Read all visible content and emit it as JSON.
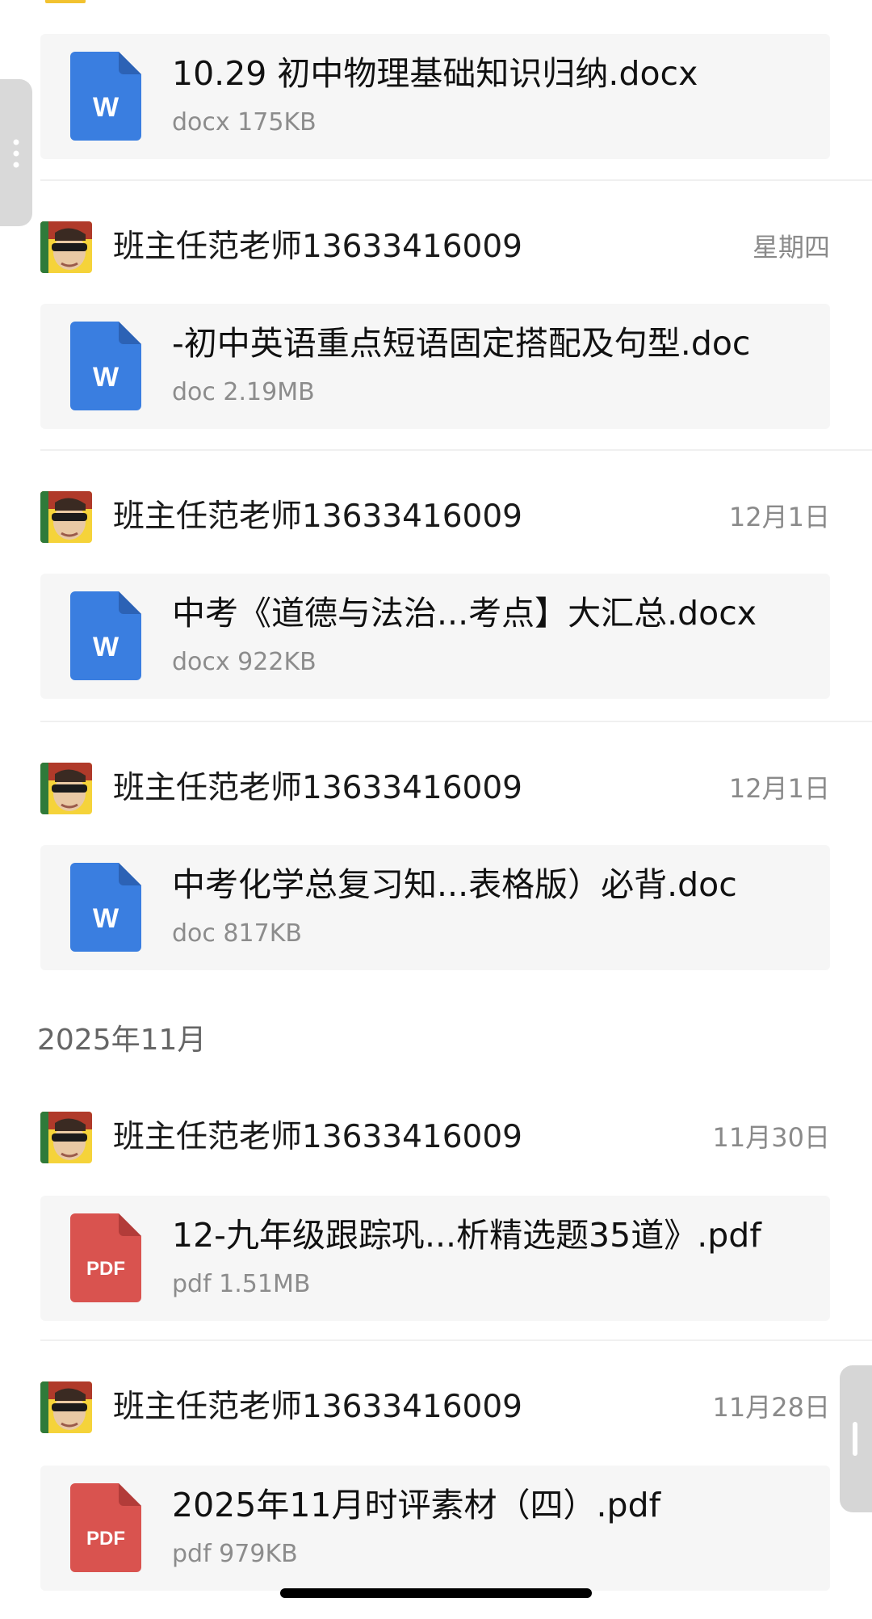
{
  "colors": {
    "word_icon": "#3a7ee0",
    "pdf_icon": "#d9534f",
    "card_background": "#f6f6f6",
    "muted_text": "#8a8a8a"
  },
  "section_header": "2025年11月",
  "messages": [
    {
      "sender": "",
      "date": "",
      "file": {
        "type_icon": "word-icon",
        "icon_text": "W",
        "name": "10.29 初中物理基础知识归纳.docx",
        "meta": "docx 175KB"
      }
    },
    {
      "sender": "班主任范老师13633416009",
      "date": "星期四",
      "file": {
        "type_icon": "word-icon",
        "icon_text": "W",
        "name": "-初中英语重点短语固定搭配及句型.doc",
        "meta": "doc 2.19MB"
      }
    },
    {
      "sender": "班主任范老师13633416009",
      "date": "12月1日",
      "file": {
        "type_icon": "word-icon",
        "icon_text": "W",
        "name": "中考《道德与法治...考点】大汇总.docx",
        "meta": "docx 922KB"
      }
    },
    {
      "sender": "班主任范老师13633416009",
      "date": "12月1日",
      "file": {
        "type_icon": "word-icon",
        "icon_text": "W",
        "name": "中考化学总复习知...表格版）必背.doc",
        "meta": "doc 817KB"
      }
    },
    {
      "sender": "班主任范老师13633416009",
      "date": "11月30日",
      "file": {
        "type_icon": "pdf-icon",
        "icon_text": "PDF",
        "name": "12-九年级跟踪巩...析精选题35道》.pdf",
        "meta": "pdf 1.51MB"
      }
    },
    {
      "sender": "班主任范老师13633416009",
      "date": "11月28日",
      "file": {
        "type_icon": "pdf-icon",
        "icon_text": "PDF",
        "name": "2025年11月时评素材（四）.pdf",
        "meta": "pdf 979KB"
      }
    }
  ]
}
